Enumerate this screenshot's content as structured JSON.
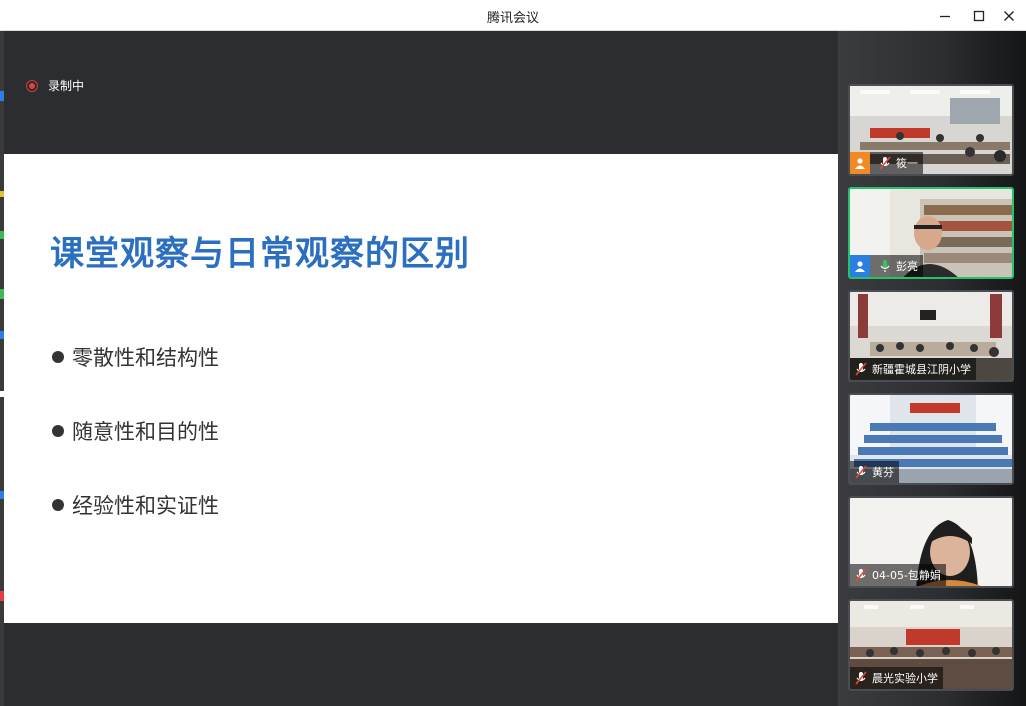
{
  "window": {
    "title": "腾讯会议"
  },
  "recording": {
    "label": "录制中"
  },
  "slide": {
    "title": "课堂观察与日常观察的区别",
    "bullets": [
      "零散性和结构性",
      "随意性和目的性",
      "经验性和实证性"
    ]
  },
  "participants": [
    {
      "name": "筱一",
      "mic": "muted",
      "avatar_color": "#f08a24",
      "scene": "classroom"
    },
    {
      "name": "彭亮",
      "mic": "on",
      "avatar_color": "#2a7fe0",
      "scene": "person-bookshelf",
      "active": true
    },
    {
      "name": "新疆霍城县江阴小学",
      "mic": "muted",
      "scene": "meeting-room"
    },
    {
      "name": "黄芬",
      "mic": "muted",
      "scene": "classroom-blue"
    },
    {
      "name": "04-05-包静娟",
      "mic": "muted",
      "scene": "person"
    },
    {
      "name": "晨光实验小学",
      "mic": "muted",
      "scene": "auditorium"
    }
  ],
  "colors": {
    "slide_title": "#2a6fc0",
    "active_speaker_border": "#27c06b",
    "mic_muted": "#e04a3a",
    "mic_on": "#34c759"
  }
}
